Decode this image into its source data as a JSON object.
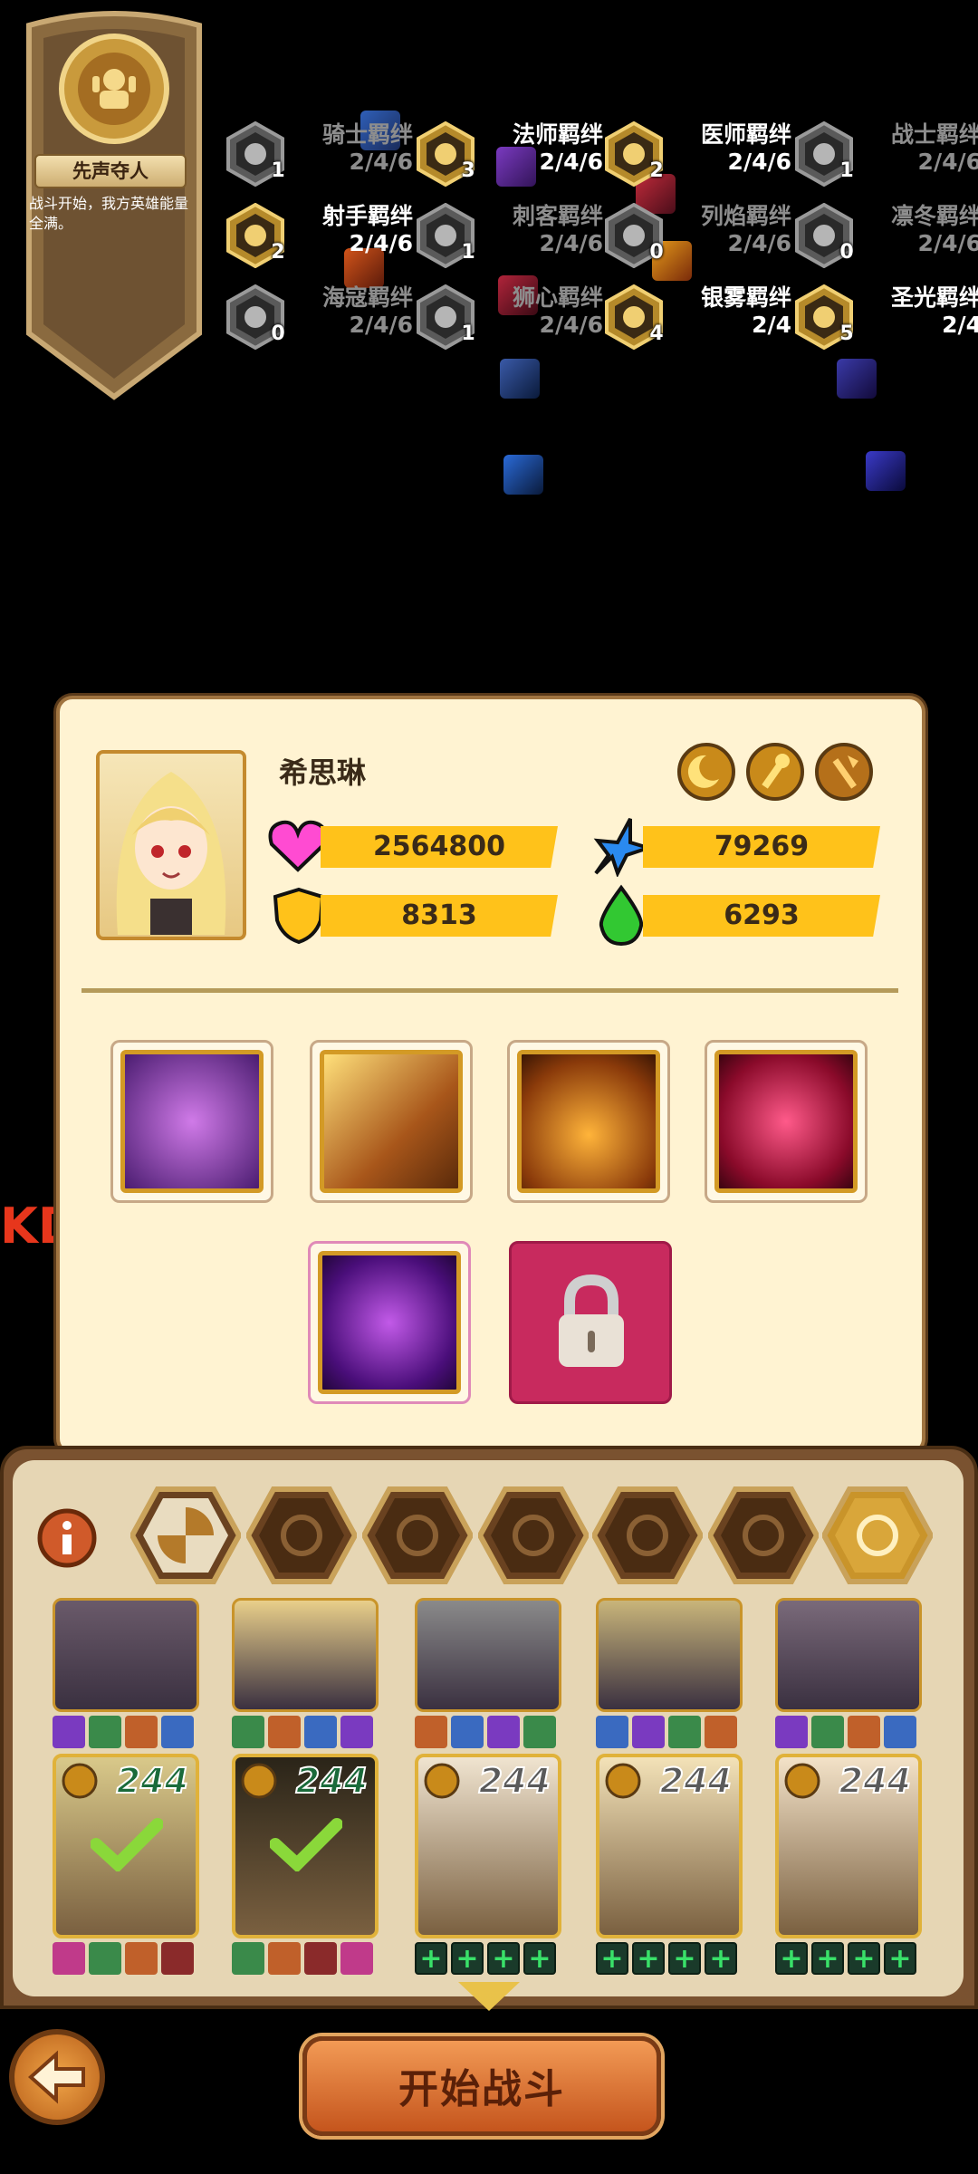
{
  "skill": {
    "title": "先声夺人",
    "description": "战斗开始，我方英雄能量全满。"
  },
  "bonds": [
    {
      "name": "骑士羁绊",
      "count": "1",
      "req": "2/4/6",
      "state": "dim",
      "icon": "sword-cross-icon"
    },
    {
      "name": "法师羁绊",
      "count": "3",
      "req": "2/4/6",
      "state": "act",
      "icon": "staff-icon"
    },
    {
      "name": "医师羁绊",
      "count": "2",
      "req": "2/4/6",
      "state": "act",
      "icon": "holy-cross-icon"
    },
    {
      "name": "战士羁绊",
      "count": "1",
      "req": "2/4/6",
      "state": "dim",
      "icon": "axe-icon"
    },
    {
      "name": "射手羁绊",
      "count": "2",
      "req": "2/4/6",
      "state": "act",
      "icon": "bow-icon"
    },
    {
      "name": "刺客羁绊",
      "count": "1",
      "req": "2/4/6",
      "state": "dim",
      "icon": "claw-icon"
    },
    {
      "name": "列焰羁绊",
      "count": "0",
      "req": "2/4/6",
      "state": "dim",
      "icon": "flame-icon"
    },
    {
      "name": "凛冬羁绊",
      "count": "0",
      "req": "2/4/6",
      "state": "dim",
      "icon": "snowflake-icon"
    },
    {
      "name": "海寇羁绊",
      "count": "0",
      "req": "2/4/6",
      "state": "dim",
      "icon": "wave-icon"
    },
    {
      "name": "狮心羁绊",
      "count": "1",
      "req": "2/4/6",
      "state": "dim",
      "icon": "leaf-icon"
    },
    {
      "name": "银雾羁绊",
      "count": "4",
      "req": "2/4",
      "state": "act",
      "icon": "eye-icon"
    },
    {
      "name": "圣光羁绊",
      "count": "5",
      "req": "2/4",
      "state": "act",
      "icon": "sun-icon"
    }
  ],
  "hero": {
    "name": "希思琳",
    "hp": "2564800",
    "attack": "79269",
    "defense": "8313",
    "speed": "6293"
  },
  "tabs": [
    "all-icon",
    "fire-icon",
    "ice-icon",
    "water-icon",
    "nature-icon",
    "shadow-icon",
    "light-icon"
  ],
  "roster_levels": [
    "244",
    "244",
    "244",
    "244",
    "244"
  ],
  "start_label": "开始战斗",
  "side_text": "KD",
  "colors": {
    "accent": "#ffc21a",
    "panel": "#fff3d2",
    "frame": "#a07440"
  }
}
